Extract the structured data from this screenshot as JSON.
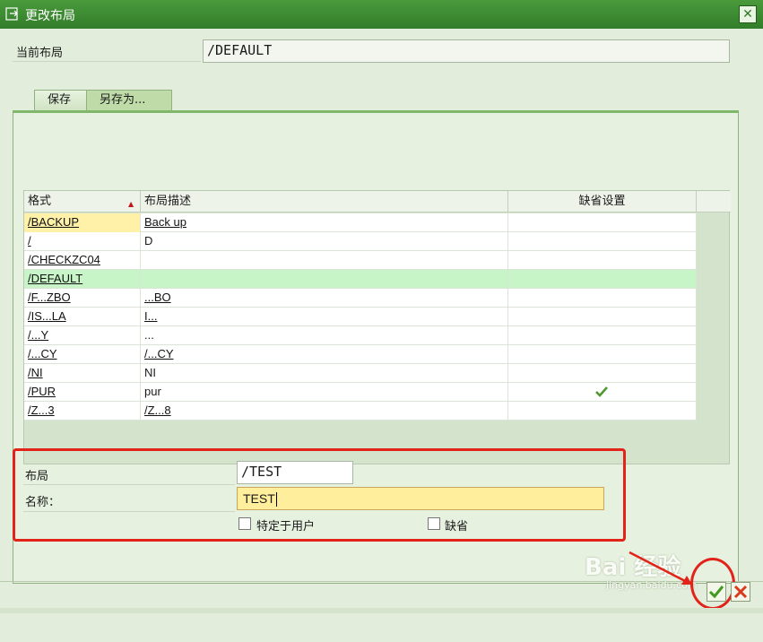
{
  "window": {
    "title": "更改布局",
    "close_icon": "close-icon"
  },
  "current_layout": {
    "label": "当前布局",
    "value": "/DEFAULT"
  },
  "tabs": [
    {
      "label": "保存"
    },
    {
      "label": "另存为..."
    }
  ],
  "table": {
    "headers": [
      "格式",
      "布局描述",
      "缺省设置"
    ],
    "rows": [
      {
        "format": "/BACKUP",
        "desc": "Back up",
        "default": ""
      },
      {
        "format": "/",
        "desc": "D",
        "default": ""
      },
      {
        "format": "/CHECKZC04",
        "desc": "",
        "default": ""
      },
      {
        "format": "/DEFAULT",
        "desc": "",
        "default": ""
      },
      {
        "format": "/F...ZBO",
        "desc": "...BO",
        "default": ""
      },
      {
        "format": "/IS...LA",
        "desc": "I...",
        "default": ""
      },
      {
        "format": "/...Y",
        "desc": "...",
        "default": ""
      },
      {
        "format": "/...CY",
        "desc": "/...CY",
        "default": ""
      },
      {
        "format": "/NI",
        "desc": "NI",
        "default": ""
      },
      {
        "format": "/PUR",
        "desc": "pur",
        "default": "check"
      },
      {
        "format": "/Z...3",
        "desc": "/Z...8",
        "default": ""
      }
    ]
  },
  "form": {
    "layout_label": "布局",
    "layout_value": "/TEST",
    "name_label": "名称：",
    "name_value": "TEST",
    "user_specific_label": "特定于用户",
    "default_label": "缺省"
  },
  "buttons": {
    "ok": "ok-check-icon",
    "cancel": "cancel-x-icon"
  },
  "watermark": {
    "text": "Bai 经验",
    "sub": "jingyan.baidu.com"
  },
  "colors": {
    "titlebar": "#3a8a30",
    "selected_row": "#c8f5c7",
    "highlight": "#fff2a8",
    "annotation": "#e2231a"
  }
}
